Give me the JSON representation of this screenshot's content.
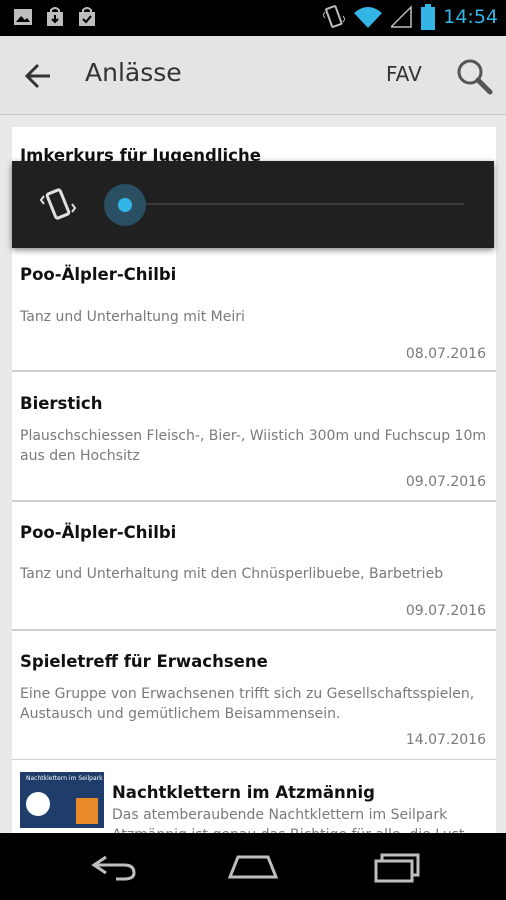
{
  "status_bar": {
    "time": "14:54",
    "left_icons": [
      "picture-icon",
      "shopping-bag-icon",
      "shopping-bag-check-icon"
    ],
    "right_icons": [
      "vibrate-icon",
      "wifi-icon",
      "signal-icon",
      "battery-icon"
    ],
    "accent_color": "#33b5e5"
  },
  "action_bar": {
    "title": "Anlässe",
    "fav_label": "FAV",
    "icons": [
      "back-arrow-icon",
      "search-icon"
    ]
  },
  "events": [
    {
      "title": "Imkerkurs für Jugendliche",
      "description": "",
      "date": ""
    },
    {
      "title": "Poo-Älpler-Chilbi",
      "description": "Tanz und Unterhaltung mit Meiri",
      "date": "08.07.2016"
    },
    {
      "title": "Bierstich",
      "description": "Plauschschiessen Fleisch-, Bier-, Wiistich 300m und Fuchscup 10m aus den Hochsitz",
      "date": "09.07.2016"
    },
    {
      "title": "Poo-Älpler-Chilbi",
      "description": "Tanz und Unterhaltung mit den Chnüsperlibuebe, Barbetrieb",
      "date": "09.07.2016"
    },
    {
      "title": "Spieletreff für Erwachsene",
      "description": "Eine Gruppe von Erwachsenen trifft sich zu Gesellschaftsspielen, Austausch und gemütlichem Beisammensein.",
      "date": "14.07.2016"
    },
    {
      "title": "Nachtklettern im Atzmännig",
      "description": "Das atemberaubende Nachtklettern im Seilpark Atzmännig ist genau das Richtige für alle, die Lust",
      "date": "",
      "thumbnail_title": "Nachtklettern im Seilpark"
    }
  ],
  "volume_overlay": {
    "mode_icon": "vibrate-icon",
    "level": 0,
    "accent_color": "#33b5e5"
  },
  "nav_bar": {
    "icons": [
      "back-nav-icon",
      "home-nav-icon",
      "recents-nav-icon"
    ]
  }
}
